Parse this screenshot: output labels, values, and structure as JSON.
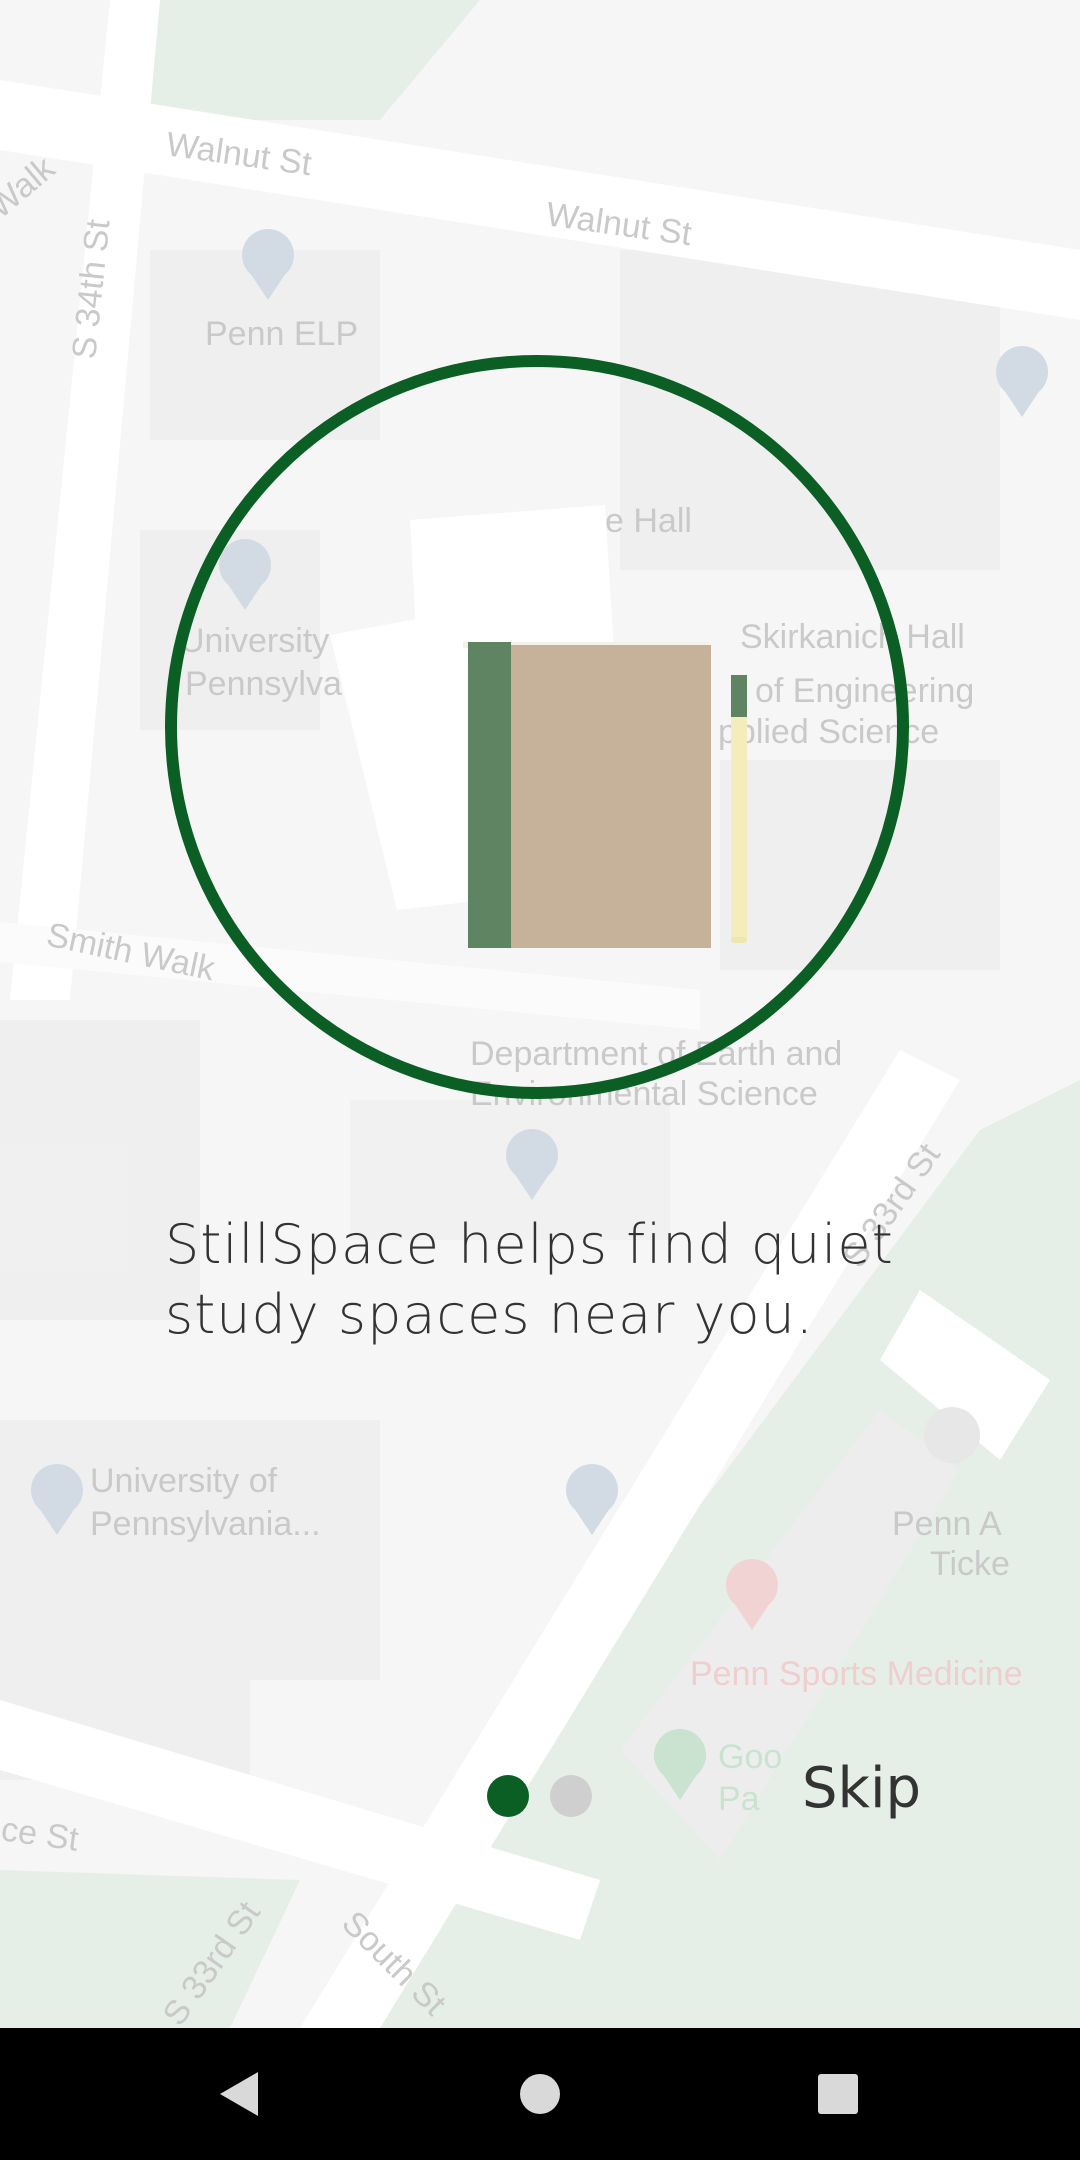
{
  "map": {
    "streets": [
      "Walnut St",
      "Walnut St",
      "S 34th St",
      "Smith Walk",
      "S 33rd St",
      "South St",
      "S 33rd St",
      "ce St",
      "Walk"
    ],
    "places": [
      "Penn ELP",
      "e Hall",
      "University",
      "Pennsylva",
      "Skirkanich Hall",
      "of Engineering",
      "pplied Science",
      "Department of Earth and",
      "Environmental Science",
      "University of",
      "Pennsylvania...",
      "Penn A",
      "Ticke",
      "Penn Sports Medicine",
      "Goo",
      "Pa"
    ]
  },
  "onboarding": {
    "tagline": "StillSpace helps find quiet study spaces near you.",
    "pages": 2,
    "current_page": 1,
    "skip_label": "Skip"
  },
  "colors": {
    "accent": "#0b5e24",
    "inactive_dot": "#cfcfcf",
    "book": "#c6b29a",
    "book_spine": "#5e8461",
    "pencil": "#f5ecbc"
  },
  "navbar": {
    "icons": [
      "back-icon",
      "home-icon",
      "recents-icon"
    ]
  }
}
